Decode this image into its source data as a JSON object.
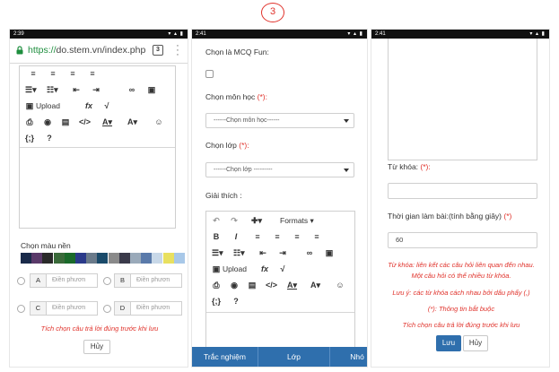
{
  "step_number": "3",
  "status": {
    "phone1_time": "2:39",
    "phone2_time": "2:41",
    "phone3_time": "2:41"
  },
  "browser": {
    "url_scheme": "https://",
    "url_rest": "do.stem.vn/index.php",
    "tab_count": "3"
  },
  "editor": {
    "upload_label": "Upload",
    "formats_label": "Formats"
  },
  "phone1": {
    "bg_color_label": "Chọn màu nền",
    "options": [
      {
        "letter": "A",
        "placeholder": "Điền phươn"
      },
      {
        "letter": "B",
        "placeholder": "Điền phươn"
      },
      {
        "letter": "C",
        "placeholder": "Điền phươn"
      },
      {
        "letter": "D",
        "placeholder": "Điền phươn"
      }
    ],
    "note": "Tích chọn câu trả lời đúng trước khi lưu",
    "cancel_label": "Hủy",
    "swatch_colors": [
      "#1a2a4a",
      "#5a3a6a",
      "#2a2a2a",
      "#3a6a3a",
      "#1a6a2a",
      "#2a3a8a",
      "#6a7a8a",
      "#1a4a6a",
      "#8a8a8a",
      "#3a3a4a",
      "#9aaaba",
      "#5a7aaa",
      "#c8d8e8",
      "#e8e060",
      "#a8c8e8"
    ]
  },
  "phone2": {
    "mcq_label": "Chọn là MCQ Fun:",
    "subject_label": "Chọn môn học ",
    "subject_req": "(*):",
    "subject_placeholder": "------Chọn môn học------",
    "class_label": "Chọn lớp ",
    "class_req": "(*):",
    "class_placeholder": "------Chọn lớp ---------",
    "explain_label": "Giải thích :",
    "nav": [
      "Trắc nghiệm",
      "Lớp",
      "Nhó"
    ]
  },
  "phone3": {
    "keyword_label": "Từ khóa: ",
    "keyword_req": "(*):",
    "time_label": "Thời gian làm bài:(tính bằng giây) ",
    "time_req": "(*)",
    "time_value": "60",
    "note1": "Từ khóa: liên kết các câu hỏi liên quan đến nhau.",
    "note2": "Một câu hỏi có thể nhiều từ khóa.",
    "note3": "Lưu ý: các từ khóa cách nhau bởi dấu phẩy (,)",
    "note4": "(*): Thông tin bắt buộc",
    "note5": "Tích chọn câu trả lời đúng trước khi lưu",
    "save_label": "Lưu",
    "cancel_label": "Hủy"
  }
}
